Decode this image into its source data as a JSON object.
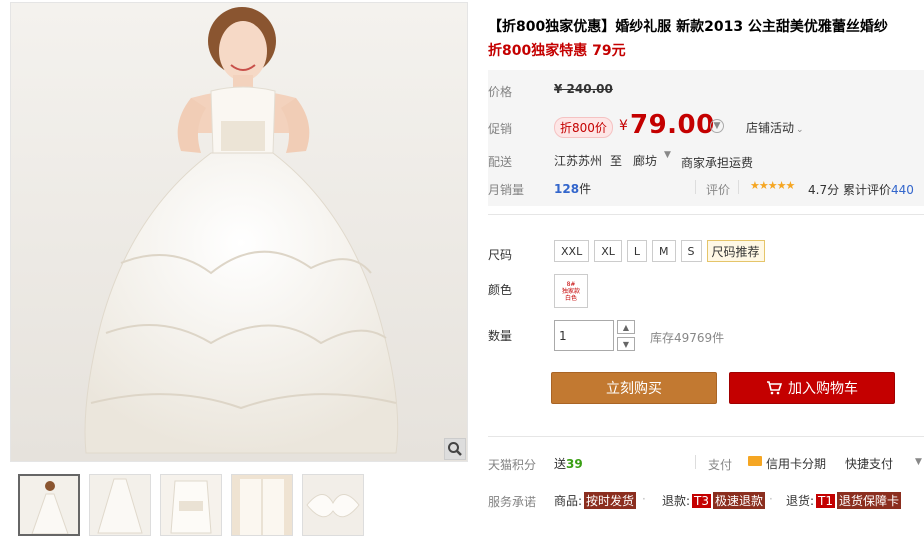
{
  "product": {
    "title": "【折800独家优惠】婚纱礼服 新款2013 公主甜美优雅蕾丝婚纱",
    "subtitle": "折800独家特惠 79元"
  },
  "price": {
    "label": "价格",
    "original": "¥ 240.00",
    "promo_label": "促销",
    "badge": "折800价",
    "currency": "¥",
    "current": "79.00",
    "shop_activity": "店铺活动"
  },
  "shipping": {
    "label": "配送",
    "from": "江苏苏州",
    "to_label": "至",
    "to": "廊坊",
    "note": "商家承担运费"
  },
  "sales": {
    "label": "月销量",
    "count": "128",
    "unit": "件",
    "rating_label": "评价",
    "stars": "★★★★★",
    "score": "4.7分",
    "review_prefix": "累计评价",
    "review_count": "440"
  },
  "options": {
    "size_label": "尺码",
    "sizes": [
      "XXL",
      "XL",
      "L",
      "M",
      "S"
    ],
    "size_recommend": "尺码推荐",
    "color_label": "颜色",
    "swatch_lines": [
      "8#",
      "独家款",
      "白色"
    ],
    "qty_label": "数量",
    "qty_value": "1",
    "stock": "库存49769件"
  },
  "actions": {
    "buy_now": "立刻购买",
    "add_to_cart": "加入购物车"
  },
  "extra": {
    "points_label": "天猫积分",
    "points_prefix": "送",
    "points_value": "39",
    "pay_label": "支付",
    "credit": "信用卡分期",
    "quick_pay": "快捷支付",
    "promise_label": "服务承诺",
    "promise_1_prefix": "商品:",
    "promise_1_tag": "按时发货",
    "promise_2_prefix": "退款:",
    "promise_2_tag1": "T3",
    "promise_2_tag2": "极速退款",
    "promise_3_prefix": "退货:",
    "promise_3_tag1": "T1",
    "promise_3_tag2": "退货保障卡"
  },
  "colors": {
    "accent_red": "#c40000",
    "buy_orange": "#c27931",
    "link_blue": "#3366cc",
    "points_green": "#3a9f14"
  },
  "icons": [
    "zoom-icon",
    "cart-icon",
    "credit-card-icon",
    "chevron-down-icon",
    "star-icon"
  ]
}
